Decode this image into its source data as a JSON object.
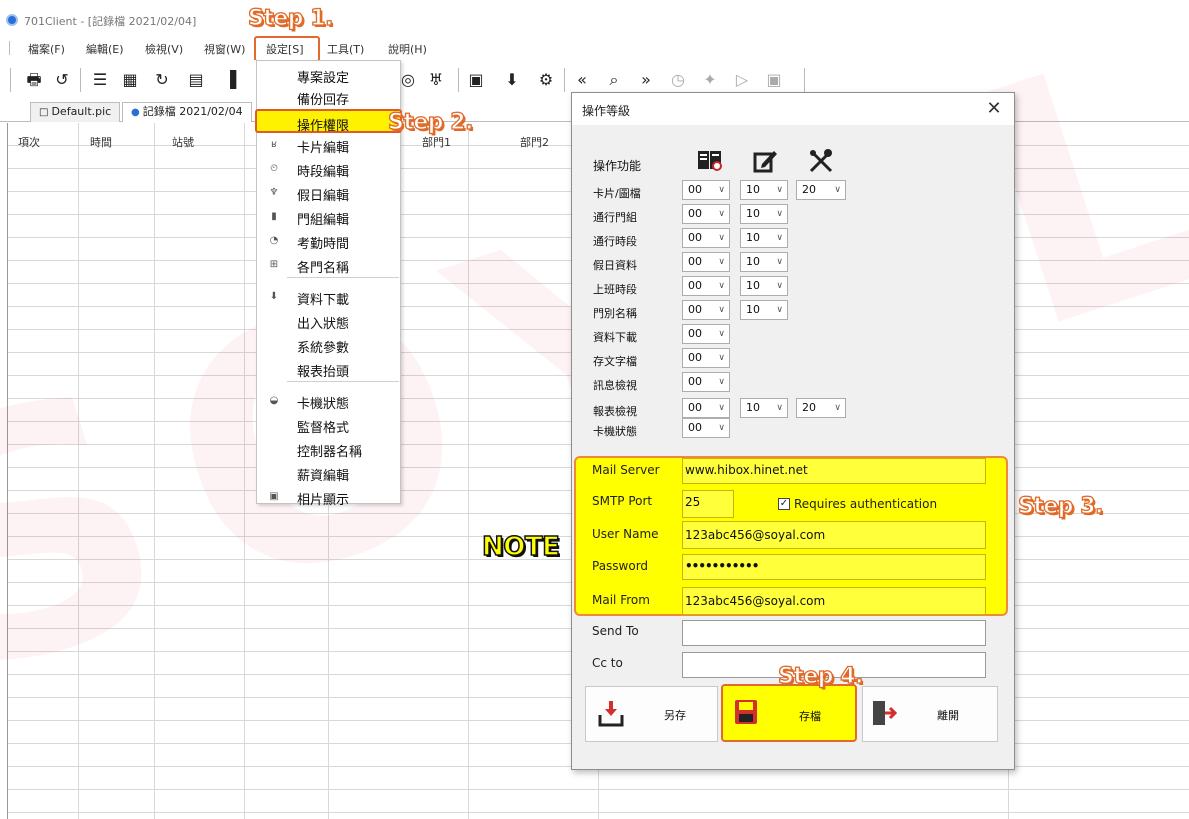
{
  "window": {
    "title": "701Client - [記錄檔 2021/02/04]"
  },
  "menubar": [
    "檔案(F)",
    "編輯(E)",
    "檢視(V)",
    "視窗(W)",
    "設定[S]",
    "工具(T)",
    "說明(H)"
  ],
  "tabs": [
    "Default.pic",
    "記錄檔 2021/02/04"
  ],
  "grid": {
    "columns": [
      "項次",
      "時間",
      "站號",
      "部門1",
      "部門2"
    ]
  },
  "dropdown": {
    "items": [
      {
        "icon": "",
        "label": "專案設定"
      },
      {
        "icon": "",
        "label": "備份回存"
      },
      {
        "icon": "",
        "label": "操作權限"
      },
      {
        "icon": "card-icon",
        "label": "卡片編輯"
      },
      {
        "icon": "clock-icon",
        "label": "時段編輯"
      },
      {
        "icon": "cocktail-icon",
        "label": "假日編輯"
      },
      {
        "icon": "door-icon",
        "label": "門組編輯"
      },
      {
        "icon": "timecard-icon",
        "label": "考勤時間"
      },
      {
        "icon": "nameplate-icon",
        "label": "各門名稱"
      },
      {
        "icon": "download-icon",
        "label": "資料下載"
      },
      {
        "icon": "",
        "label": "出入狀態"
      },
      {
        "icon": "",
        "label": "系統參數"
      },
      {
        "icon": "",
        "label": "報表抬頭"
      },
      {
        "icon": "controller-icon",
        "label": "卡機狀態"
      },
      {
        "icon": "",
        "label": "監督格式"
      },
      {
        "icon": "",
        "label": "控制器名稱"
      },
      {
        "icon": "",
        "label": "薪資編輯"
      },
      {
        "icon": "photo-icon",
        "label": "相片顯示"
      }
    ]
  },
  "dialog": {
    "title": "操作等級",
    "header_label": "操作功能",
    "rows": [
      {
        "label": "卡片/圖檔",
        "v1": "00",
        "v2": "10",
        "v3": "20"
      },
      {
        "label": "通行門組",
        "v1": "00",
        "v2": "10",
        "v3": null
      },
      {
        "label": "通行時段",
        "v1": "00",
        "v2": "10",
        "v3": null
      },
      {
        "label": "假日資料",
        "v1": "00",
        "v2": "10",
        "v3": null
      },
      {
        "label": "上班時段",
        "v1": "00",
        "v2": "10",
        "v3": null
      },
      {
        "label": "門別名稱",
        "v1": "00",
        "v2": "10",
        "v3": null
      },
      {
        "label": "資料下載",
        "v1": "00",
        "v2": null,
        "v3": null
      },
      {
        "label": "存文字檔",
        "v1": "00",
        "v2": null,
        "v3": null
      },
      {
        "label": "訊息檢視",
        "v1": "00",
        "v2": null,
        "v3": null
      },
      {
        "label": "報表檢視",
        "v1": "00",
        "v2": "10",
        "v3": "20"
      },
      {
        "label": "卡機狀態",
        "v1": "00",
        "v2": null,
        "v3": null
      }
    ],
    "mail": {
      "server_label": "Mail Server",
      "server": "www.hibox.hinet.net",
      "port_label": "SMTP Port",
      "port": "25",
      "auth_label": "Requires authentication",
      "auth_checked": true,
      "user_label": "User Name",
      "user": "123abc456@soyal.com",
      "password_label": "Password",
      "password": "•••••••••••",
      "from_label": "Mail From",
      "from": "123abc456@soyal.com",
      "sendto_label": "Send To",
      "sendto": "",
      "cc_label": "Cc to",
      "cc": ""
    },
    "buttons": {
      "saveas": "另存",
      "save": "存檔",
      "exit": "離開"
    }
  },
  "callouts": {
    "step1": "Step 1.",
    "step2": "Step 2.",
    "step3": "Step 3.",
    "step4": "Step 4.",
    "note": "NOTE"
  },
  "watermark": "SOYAL",
  "colors": {
    "highlight": "#ffff00",
    "callout_outline": "#e06a28",
    "accent_blue": "#2a6fd6"
  }
}
